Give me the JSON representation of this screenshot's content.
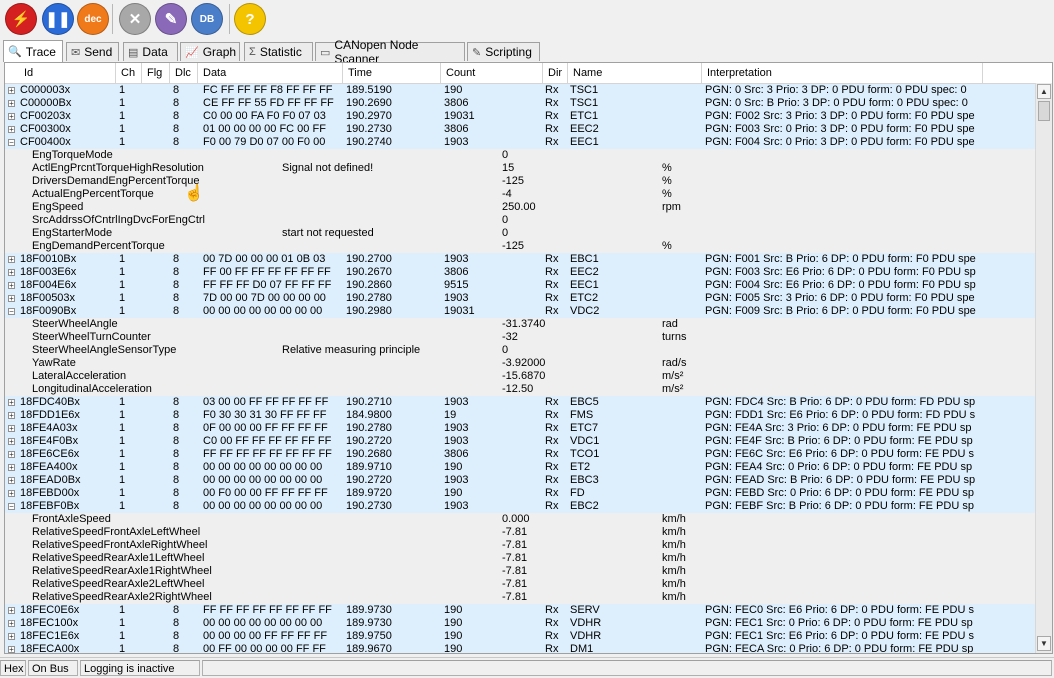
{
  "toolbar": {
    "buttons": [
      {
        "name": "connect-button",
        "icon": "lightning-icon",
        "color": "#d42020",
        "glyph": "⚡",
        "label": ""
      },
      {
        "name": "pause-button",
        "icon": "pause-icon",
        "color": "#2a6bd8",
        "glyph": "❚❚",
        "label": ""
      },
      {
        "name": "dec-button",
        "icon": "dec-icon",
        "color": "#f07a1a",
        "glyph": "",
        "label": "dec"
      },
      {
        "name": "settings-button",
        "icon": "tools-icon",
        "color": "#a8a8a8",
        "glyph": "✕",
        "label": ""
      },
      {
        "name": "edit-button",
        "icon": "pencil-icon",
        "color": "#8a6ab8",
        "glyph": "✎",
        "label": ""
      },
      {
        "name": "database-button",
        "icon": "database-icon",
        "color": "#4a7ec8",
        "glyph": "",
        "label": "DB"
      },
      {
        "name": "help-button",
        "icon": "help-icon",
        "color": "#f4c400",
        "glyph": "?",
        "label": ""
      }
    ]
  },
  "tabs": [
    {
      "label": "Trace",
      "icon": "search-icon",
      "glyph": "🔍"
    },
    {
      "label": "Send",
      "icon": "send-icon",
      "glyph": "✉"
    },
    {
      "label": "Data",
      "icon": "data-icon",
      "glyph": "▤"
    },
    {
      "label": "Graph",
      "icon": "graph-icon",
      "glyph": "📈"
    },
    {
      "label": "Statistic",
      "icon": "sigma-icon",
      "glyph": "Σ"
    },
    {
      "label": "CANopen Node Scanner",
      "icon": "scanner-icon",
      "glyph": "▭"
    },
    {
      "label": "Scripting",
      "icon": "script-icon",
      "glyph": "✎"
    }
  ],
  "columns": [
    "Id",
    "Ch",
    "Flg",
    "Dlc",
    "Data",
    "Time",
    "Count",
    "Dir",
    "Name",
    "Interpretation"
  ],
  "rows": [
    {
      "type": "msg",
      "id": "C000003x",
      "ch": "1",
      "flg": "",
      "dlc": "8",
      "data": "FC FF FF FF F8 FF FF FF",
      "time": "189.5190",
      "count": "190",
      "dir": "Rx",
      "name": "TSC1",
      "interp": "PGN: 0 Src: 3 Prio: 3 DP: 0 PDU form: 0 PDU spec: 0"
    },
    {
      "type": "msg",
      "id": "C00000Bx",
      "ch": "1",
      "flg": "",
      "dlc": "8",
      "data": "CE FF FF 55 FD FF FF FF",
      "time": "190.2690",
      "count": "3806",
      "dir": "Rx",
      "name": "TSC1",
      "interp": "PGN: 0 Src: B Prio: 3 DP: 0 PDU form: 0 PDU spec: 0"
    },
    {
      "type": "msg",
      "id": "CF00203x",
      "ch": "1",
      "flg": "",
      "dlc": "8",
      "data": "C0 00 00 FA F0 F0 07 03",
      "time": "190.2970",
      "count": "19031",
      "dir": "Rx",
      "name": "ETC1",
      "interp": "PGN: F002 Src: 3 Prio: 3 DP: 0 PDU form: F0 PDU spe"
    },
    {
      "type": "msg",
      "id": "CF00300x",
      "ch": "1",
      "flg": "",
      "dlc": "8",
      "data": "01 00 00 00 00 FC 00 FF",
      "time": "190.2730",
      "count": "3806",
      "dir": "Rx",
      "name": "EEC2",
      "interp": "PGN: F003 Src: 0 Prio: 3 DP: 0 PDU form: F0 PDU spe"
    },
    {
      "type": "msg",
      "id": "CF00400x",
      "ch": "1",
      "flg": "",
      "dlc": "8",
      "data": "F0 00 79 D0 07 00 F0 00",
      "time": "190.2740",
      "count": "1903",
      "dir": "Rx",
      "name": "EEC1",
      "interp": "PGN: F004 Src: 0 Prio: 3 DP: 0 PDU form: F0 PDU spe"
    },
    {
      "type": "sig",
      "sname": "EngTorqueMode",
      "sdesc": "",
      "sval": "0",
      "sunit": ""
    },
    {
      "type": "sig",
      "sname": "ActlEngPrcntTorqueHighResolution",
      "sdesc": "Signal not defined!",
      "sval": "15",
      "sunit": "%"
    },
    {
      "type": "sig",
      "sname": "DriversDemandEngPercentTorque",
      "sdesc": "",
      "sval": "-125",
      "sunit": "%"
    },
    {
      "type": "sig",
      "sname": "ActualEngPercentTorque",
      "sdesc": "",
      "sval": "-4",
      "sunit": "%"
    },
    {
      "type": "sig",
      "sname": "EngSpeed",
      "sdesc": "",
      "sval": "250.00",
      "sunit": "rpm"
    },
    {
      "type": "sig",
      "sname": "SrcAddrssOfCntrlIngDvcForEngCtrl",
      "sdesc": "",
      "sval": "0",
      "sunit": ""
    },
    {
      "type": "sig",
      "sname": "EngStarterMode",
      "sdesc": "start not requested",
      "sval": "0",
      "sunit": ""
    },
    {
      "type": "sig",
      "sname": "EngDemandPercentTorque",
      "sdesc": "",
      "sval": "-125",
      "sunit": "%"
    },
    {
      "type": "msg",
      "id": "18F0010Bx",
      "ch": "1",
      "flg": "",
      "dlc": "8",
      "data": "00 7D 00 00 00 01 0B 03",
      "time": "190.2700",
      "count": "1903",
      "dir": "Rx",
      "name": "EBC1",
      "interp": "PGN: F001 Src: B Prio: 6 DP: 0 PDU form: F0 PDU spe"
    },
    {
      "type": "msg",
      "id": "18F003E6x",
      "ch": "1",
      "flg": "",
      "dlc": "8",
      "data": "FF 00 FF FF FF FF FF FF",
      "time": "190.2670",
      "count": "3806",
      "dir": "Rx",
      "name": "EEC2",
      "interp": "PGN: F003 Src: E6 Prio: 6 DP: 0 PDU form: F0 PDU sp"
    },
    {
      "type": "msg",
      "id": "18F004E6x",
      "ch": "1",
      "flg": "",
      "dlc": "8",
      "data": "FF FF FF D0 07 FF FF FF",
      "time": "190.2860",
      "count": "9515",
      "dir": "Rx",
      "name": "EEC1",
      "interp": "PGN: F004 Src: E6 Prio: 6 DP: 0 PDU form: F0 PDU sp"
    },
    {
      "type": "msg",
      "id": "18F00503x",
      "ch": "1",
      "flg": "",
      "dlc": "8",
      "data": "7D 00 00 7D 00 00 00 00",
      "time": "190.2780",
      "count": "1903",
      "dir": "Rx",
      "name": "ETC2",
      "interp": "PGN: F005 Src: 3 Prio: 6 DP: 0 PDU form: F0 PDU spe"
    },
    {
      "type": "msg",
      "id": "18F0090Bx",
      "ch": "1",
      "flg": "",
      "dlc": "8",
      "data": "00 00 00 00 00 00 00 00",
      "time": "190.2980",
      "count": "19031",
      "dir": "Rx",
      "name": "VDC2",
      "interp": "PGN: F009 Src: B Prio: 6 DP: 0 PDU form: F0 PDU spe"
    },
    {
      "type": "sig",
      "sname": "SteerWheelAngle",
      "sdesc": "",
      "sval": "-31.3740",
      "sunit": "rad"
    },
    {
      "type": "sig",
      "sname": "SteerWheelTurnCounter",
      "sdesc": "",
      "sval": "-32",
      "sunit": "turns"
    },
    {
      "type": "sig",
      "sname": "SteerWheelAngleSensorType",
      "sdesc": "Relative measuring principle",
      "sval": "0",
      "sunit": ""
    },
    {
      "type": "sig",
      "sname": "YawRate",
      "sdesc": "",
      "sval": "-3.92000",
      "sunit": "rad/s"
    },
    {
      "type": "sig",
      "sname": "LateralAcceleration",
      "sdesc": "",
      "sval": "-15.6870",
      "sunit": "m/s²"
    },
    {
      "type": "sig",
      "sname": "LongitudinalAcceleration",
      "sdesc": "",
      "sval": "-12.50",
      "sunit": "m/s²"
    },
    {
      "type": "msg",
      "id": "18FDC40Bx",
      "ch": "1",
      "flg": "",
      "dlc": "8",
      "data": "03 00 00 FF FF FF FF FF",
      "time": "190.2710",
      "count": "1903",
      "dir": "Rx",
      "name": "EBC5",
      "interp": "PGN: FDC4 Src: B Prio: 6 DP: 0 PDU form: FD PDU sp"
    },
    {
      "type": "msg",
      "id": "18FDD1E6x",
      "ch": "1",
      "flg": "",
      "dlc": "8",
      "data": "F0 30 30 31 30 FF FF FF",
      "time": "184.9800",
      "count": "19",
      "dir": "Rx",
      "name": "FMS",
      "interp": "PGN: FDD1 Src: E6 Prio: 6 DP: 0 PDU form: FD PDU s"
    },
    {
      "type": "msg",
      "id": "18FE4A03x",
      "ch": "1",
      "flg": "",
      "dlc": "8",
      "data": "0F 00 00 00 FF FF FF FF",
      "time": "190.2780",
      "count": "1903",
      "dir": "Rx",
      "name": "ETC7",
      "interp": "PGN: FE4A Src: 3 Prio: 6 DP: 0 PDU form: FE PDU sp"
    },
    {
      "type": "msg",
      "id": "18FE4F0Bx",
      "ch": "1",
      "flg": "",
      "dlc": "8",
      "data": "C0 00 FF FF FF FF FF FF",
      "time": "190.2720",
      "count": "1903",
      "dir": "Rx",
      "name": "VDC1",
      "interp": "PGN: FE4F Src: B Prio: 6 DP: 0 PDU form: FE PDU sp"
    },
    {
      "type": "msg",
      "id": "18FE6CE6x",
      "ch": "1",
      "flg": "",
      "dlc": "8",
      "data": "FF FF FF FF FF FF FF FF",
      "time": "190.2680",
      "count": "3806",
      "dir": "Rx",
      "name": "TCO1",
      "interp": "PGN: FE6C Src: E6 Prio: 6 DP: 0 PDU form: FE PDU s"
    },
    {
      "type": "msg",
      "id": "18FEA400x",
      "ch": "1",
      "flg": "",
      "dlc": "8",
      "data": "00 00 00 00 00 00 00 00",
      "time": "189.9710",
      "count": "190",
      "dir": "Rx",
      "name": "ET2",
      "interp": "PGN: FEA4 Src: 0 Prio: 6 DP: 0 PDU form: FE PDU sp"
    },
    {
      "type": "msg",
      "id": "18FEAD0Bx",
      "ch": "1",
      "flg": "",
      "dlc": "8",
      "data": "00 00 00 00 00 00 00 00",
      "time": "190.2720",
      "count": "1903",
      "dir": "Rx",
      "name": "EBC3",
      "interp": "PGN: FEAD Src: B Prio: 6 DP: 0 PDU form: FE PDU sp"
    },
    {
      "type": "msg",
      "id": "18FEBD00x",
      "ch": "1",
      "flg": "",
      "dlc": "8",
      "data": "00 F0 00 00 FF FF FF FF",
      "time": "189.9720",
      "count": "190",
      "dir": "Rx",
      "name": "FD",
      "interp": "PGN: FEBD Src: 0 Prio: 6 DP: 0 PDU form: FE PDU sp"
    },
    {
      "type": "msg",
      "id": "18FEBF0Bx",
      "ch": "1",
      "flg": "",
      "dlc": "8",
      "data": "00 00 00 00 00 00 00 00",
      "time": "190.2730",
      "count": "1903",
      "dir": "Rx",
      "name": "EBC2",
      "interp": "PGN: FEBF Src: B Prio: 6 DP: 0 PDU form: FE PDU sp"
    },
    {
      "type": "sig",
      "sname": "FrontAxleSpeed",
      "sdesc": "",
      "sval": "0.000",
      "sunit": "km/h"
    },
    {
      "type": "sig",
      "sname": "RelativeSpeedFrontAxleLeftWheel",
      "sdesc": "",
      "sval": "-7.81",
      "sunit": "km/h"
    },
    {
      "type": "sig",
      "sname": "RelativeSpeedFrontAxleRightWheel",
      "sdesc": "",
      "sval": "-7.81",
      "sunit": "km/h"
    },
    {
      "type": "sig",
      "sname": "RelativeSpeedRearAxle1LeftWheel",
      "sdesc": "",
      "sval": "-7.81",
      "sunit": "km/h"
    },
    {
      "type": "sig",
      "sname": "RelativeSpeedRearAxle1RightWheel",
      "sdesc": "",
      "sval": "-7.81",
      "sunit": "km/h"
    },
    {
      "type": "sig",
      "sname": "RelativeSpeedRearAxle2LeftWheel",
      "sdesc": "",
      "sval": "-7.81",
      "sunit": "km/h"
    },
    {
      "type": "sig",
      "sname": "RelativeSpeedRearAxle2RightWheel",
      "sdesc": "",
      "sval": "-7.81",
      "sunit": "km/h"
    },
    {
      "type": "msg",
      "id": "18FEC0E6x",
      "ch": "1",
      "flg": "",
      "dlc": "8",
      "data": "FF FF FF FF FF FF FF FF",
      "time": "189.9730",
      "count": "190",
      "dir": "Rx",
      "name": "SERV",
      "interp": "PGN: FEC0 Src: E6 Prio: 6 DP: 0 PDU form: FE PDU s"
    },
    {
      "type": "msg",
      "id": "18FEC100x",
      "ch": "1",
      "flg": "",
      "dlc": "8",
      "data": "00 00 00 00 00 00 00 00",
      "time": "189.9730",
      "count": "190",
      "dir": "Rx",
      "name": "VDHR",
      "interp": "PGN: FEC1 Src: 0 Prio: 6 DP: 0 PDU form: FE PDU sp"
    },
    {
      "type": "msg",
      "id": "18FEC1E6x",
      "ch": "1",
      "flg": "",
      "dlc": "8",
      "data": "00 00 00 00 FF FF FF FF",
      "time": "189.9750",
      "count": "190",
      "dir": "Rx",
      "name": "VDHR",
      "interp": "PGN: FEC1 Src: E6 Prio: 6 DP: 0 PDU form: FE PDU s"
    },
    {
      "type": "msg",
      "id": "18FECA00x",
      "ch": "1",
      "flg": "",
      "dlc": "8",
      "data": "00 FF 00 00 00 00 FF FF",
      "time": "189.9670",
      "count": "190",
      "dir": "Rx",
      "name": "DM1",
      "interp": "PGN: FECA Src: 0 Prio: 6 DP: 0 PDU form: FE PDU sp"
    }
  ],
  "status": {
    "format": "Hex",
    "bus": "On Bus",
    "logging": "Logging is inactive"
  },
  "colors": {
    "message_row": "#ddeefc",
    "signal_row": "#efefef"
  }
}
